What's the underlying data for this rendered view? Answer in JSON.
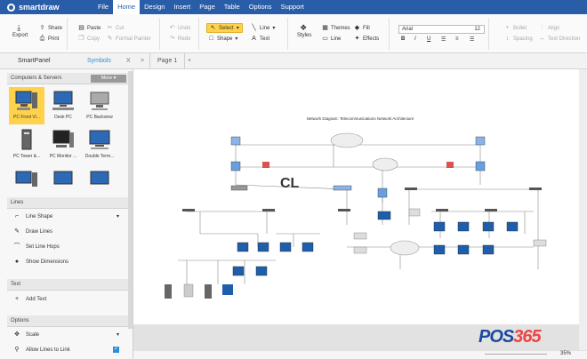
{
  "app": {
    "logo": "smartdraw"
  },
  "menu": [
    "File",
    "Home",
    "Design",
    "Insert",
    "Page",
    "Table",
    "Options",
    "Support"
  ],
  "menu_active": "Home",
  "ribbon": {
    "export": "Export",
    "share": "Share",
    "print": "Print",
    "paste": "Paste",
    "cut": "Cut",
    "copy": "Copy",
    "format_painter": "Format Painter",
    "undo": "Undo",
    "redo": "Redo",
    "select": "Select",
    "shape": "Shape",
    "line": "Line",
    "text": "Text",
    "styles": "Styles",
    "themes": "Themes",
    "fill": "Fill",
    "line2": "Line",
    "effects": "Effects",
    "font": "Arial",
    "font_size": "12",
    "bullet": "Bullet",
    "spacing": "Spacing",
    "align": "Align",
    "text_direction": "Text Direction",
    "bold": "B",
    "italic": "I",
    "underline": "U"
  },
  "tabs": {
    "smartpanel": "SmartPanel",
    "symbols": "Symbols",
    "close": "X",
    "nav": ">",
    "page": "Page 1",
    "add": "+"
  },
  "panel": {
    "category": "Computers & Servers",
    "more": "More",
    "symbols": [
      "PC Front Vi...",
      "Desk PC",
      "PC Backview",
      "PC Tower &...",
      "PC Monitor ...",
      "Double Term..."
    ],
    "lines_header": "Lines",
    "line_items": [
      "Line Shape",
      "Draw Lines",
      "Set Line Hops",
      "Show Dimensions"
    ],
    "text_header": "Text",
    "text_items": [
      "Add Text"
    ],
    "options_header": "Options",
    "option_items": [
      "Scale",
      "Allow Lines to Link"
    ]
  },
  "canvas": {
    "diagram_title": "Network Diagram: Telecommunications Network Architecture",
    "overlay": "CL"
  },
  "status": {
    "zoom": "35%"
  },
  "watermark": {
    "brand": "POS",
    "number": "365"
  }
}
